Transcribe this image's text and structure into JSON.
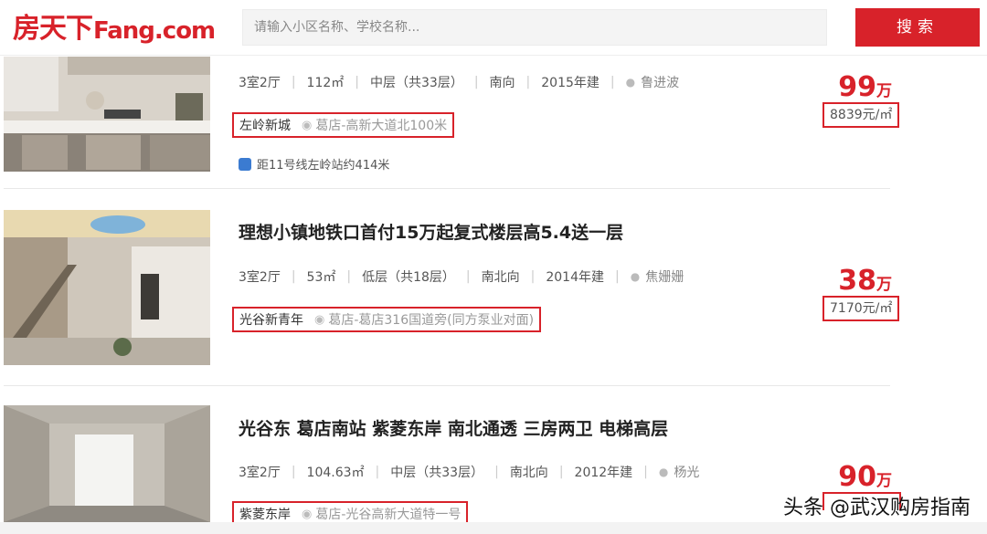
{
  "header": {
    "logo_cn": "房天下",
    "logo_en": "Fang.com",
    "search_placeholder": "请输入小区名称、学校名称...",
    "search_button": "搜索"
  },
  "listings": [
    {
      "title": "",
      "layout": "3室2厅",
      "area": "112㎡",
      "floor": "中层（共33层）",
      "orientation": "南向",
      "year": "2015年建",
      "agent": "鲁进波",
      "community": "左岭新城",
      "address": "葛店-高新大道北100米",
      "metro": "距11号线左岭站约414米",
      "price_num": "99",
      "price_unit": "万",
      "unit_price": "8839元/㎡"
    },
    {
      "title": "理想小镇地铁口首付15万起复式楼层高5.4送一层",
      "layout": "3室2厅",
      "area": "53㎡",
      "floor": "低层（共18层）",
      "orientation": "南北向",
      "year": "2014年建",
      "agent": "焦姗姗",
      "community": "光谷新青年",
      "address": "葛店-葛店316国道旁(同方泵业对面)",
      "price_num": "38",
      "price_unit": "万",
      "unit_price": "7170元/㎡"
    },
    {
      "title": "光谷东 葛店南站 紫菱东岸 南北通透 三房两卫 电梯高层",
      "layout": "3室2厅",
      "area": "104.63㎡",
      "floor": "中层（共33层）",
      "orientation": "南北向",
      "year": "2012年建",
      "agent": "杨光",
      "community": "紫菱东岸",
      "address": "葛店-光谷高新大道特一号",
      "price_num": "90",
      "price_unit": "万"
    }
  ],
  "watermark": "头条 @武汉购房指南",
  "colors": {
    "brand_red": "#d8222a",
    "metro_blue": "#3b7bd1"
  }
}
